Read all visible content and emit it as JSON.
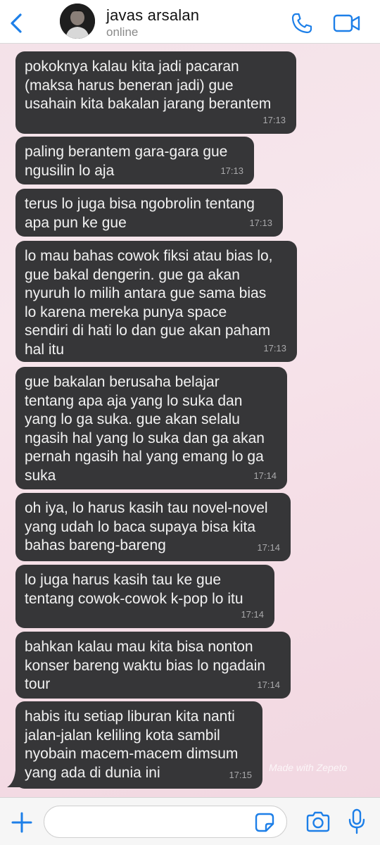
{
  "header": {
    "contact_name": "javas arsalan",
    "status": "online",
    "icons": {
      "back": "chevron-left-icon",
      "call": "phone-icon",
      "video": "video-camera-icon"
    },
    "accent_color": "#1d7fe8"
  },
  "messages": [
    {
      "text": "pokoknya kalau kita jadi pacaran\n(maksa harus beneran jadi) gue\nusahain kita bakalan jarang berantem",
      "time": "17:13"
    },
    {
      "text": "paling berantem gara-gara gue\nngusilin lo aja",
      "time": "17:13"
    },
    {
      "text": "terus lo juga bisa ngobrolin tentang\napa pun ke gue",
      "time": "17:13"
    },
    {
      "text": "lo mau bahas cowok fiksi atau bias lo,\ngue bakal dengerin. gue ga akan\nnyuruh lo milih antara gue sama bias\nlo karena mereka punya space\nsendiri di hati lo dan gue akan paham\nhal itu",
      "time": "17:13"
    },
    {
      "text": "gue bakalan berusaha belajar\ntentang apa aja yang lo suka dan\nyang lo ga suka. gue akan selalu\nngasih hal yang lo suka dan ga akan\npernah ngasih hal yang emang lo ga\nsuka",
      "time": "17:14"
    },
    {
      "text": "oh iya, lo harus kasih tau novel-novel\nyang udah lo baca supaya bisa kita\nbahas bareng-bareng",
      "time": "17:14"
    },
    {
      "text": "lo juga harus kasih tau ke gue\ntentang cowok-cowok k-pop lo itu",
      "time": "17:14"
    },
    {
      "text": "bahkan kalau mau kita bisa nonton\nkonser bareng waktu bias lo ngadain\ntour",
      "time": "17:14"
    },
    {
      "text": "habis itu setiap liburan kita nanti\njalan-jalan keliling kota sambil\nnyobain macem-macem dimsum\nyang ada di dunia ini",
      "time": "17:15"
    }
  ],
  "watermark": "Made with Zepeto",
  "input_bar": {
    "placeholder": "",
    "icons": {
      "add": "plus-icon",
      "sticker": "sticker-icon",
      "camera": "camera-icon",
      "mic": "microphone-icon"
    }
  },
  "colors": {
    "bubble_bg": "#363638",
    "bubble_text": "#f2f2f2",
    "timestamp": "#a9a9ab"
  }
}
